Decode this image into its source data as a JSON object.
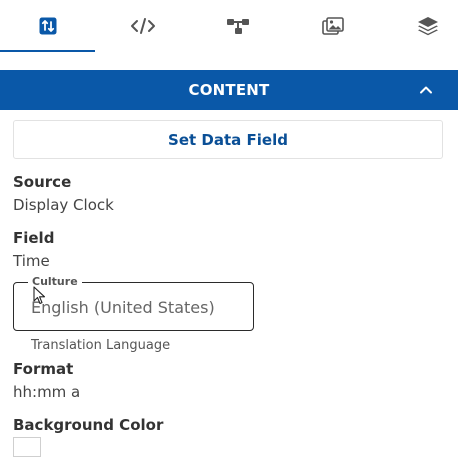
{
  "toolbar": {
    "tabs": [
      {
        "icon": "sort-arrows-icon",
        "active": true
      },
      {
        "icon": "code-icon",
        "active": false
      },
      {
        "icon": "sitemap-icon",
        "active": false
      },
      {
        "icon": "images-icon",
        "active": false
      },
      {
        "icon": "layers-icon",
        "active": false
      }
    ]
  },
  "section": {
    "title": "CONTENT",
    "collapse_icon": "chevron-up-icon"
  },
  "set_data_field": {
    "label": "Set Data Field"
  },
  "source": {
    "label": "Source",
    "value": "Display Clock"
  },
  "field": {
    "label": "Field",
    "value": "Time"
  },
  "culture": {
    "label": "Culture",
    "value": "English (United States)",
    "helper": "Translation Language"
  },
  "format": {
    "label": "Format",
    "value": "hh:mm a"
  },
  "background_color": {
    "label": "Background Color",
    "value": "#ffffff"
  },
  "colors": {
    "accent": "#0a58a8",
    "icon": "#555555",
    "active_icon": "#0a58a8"
  }
}
